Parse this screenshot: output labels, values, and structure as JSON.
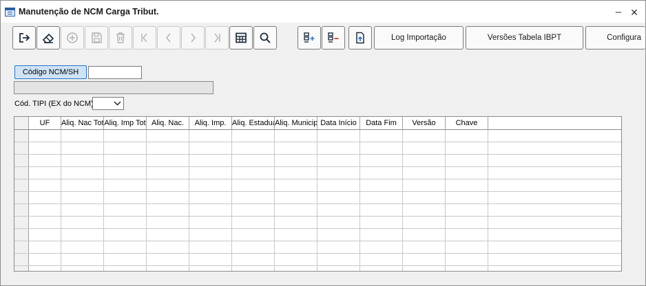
{
  "window": {
    "title": "Manutenção de NCM Carga Tribut.",
    "minimize_glyph": "–",
    "close_glyph": "✕"
  },
  "toolbar": {
    "icon_buttons": [
      {
        "name": "exit-button",
        "icon": "exit-icon",
        "enabled": true
      },
      {
        "name": "clear-button",
        "icon": "eraser-icon",
        "enabled": true
      },
      {
        "name": "add-button",
        "icon": "plus-circle-icon",
        "enabled": false
      },
      {
        "name": "save-button",
        "icon": "save-icon",
        "enabled": false
      },
      {
        "name": "delete-button",
        "icon": "trash-icon",
        "enabled": false
      },
      {
        "name": "first-record-button",
        "icon": "first-icon",
        "enabled": false
      },
      {
        "name": "previous-record-button",
        "icon": "chevron-left-icon",
        "enabled": false
      },
      {
        "name": "next-record-button",
        "icon": "chevron-right-icon",
        "enabled": false
      },
      {
        "name": "last-record-button",
        "icon": "last-icon",
        "enabled": false
      },
      {
        "name": "grid-view-button",
        "icon": "table-icon",
        "enabled": true
      },
      {
        "name": "search-button",
        "icon": "search-icon",
        "enabled": true
      },
      {
        "name": "add-row-button",
        "icon": "list-add-icon",
        "enabled": true
      },
      {
        "name": "remove-row-button",
        "icon": "list-remove-icon",
        "enabled": true
      },
      {
        "name": "import-file-button",
        "icon": "file-upload-icon",
        "enabled": true
      }
    ],
    "log_import_label": "Log Importação",
    "ibpt_versions_label": "Versões Tabela IBPT",
    "configure_label": "Configura"
  },
  "form": {
    "ncm_button_label": "Código NCM/SH",
    "ncm_value": "",
    "description_value": "",
    "tipi_label": "Cód. TIPI (EX do NCM)",
    "tipi_value": ""
  },
  "grid": {
    "columns": [
      "UF",
      "Aliq. Nac Tot",
      "Aliq. Imp Tot",
      "Aliq. Nac.",
      "Aliq. Imp.",
      "Aliq. Estadual",
      "Aliq. Municipal",
      "Data Início",
      "Data Fim",
      "Versão",
      "Chave"
    ],
    "rows": [
      [],
      [],
      [],
      [],
      [],
      [],
      [],
      [],
      [],
      [],
      [],
      []
    ]
  },
  "colors": {
    "accent_blue": "#2a72c4",
    "button_selected_bg": "#cfe3f7",
    "icon_dark": "#1f2d3d",
    "icon_disabled": "#b4b4b4"
  }
}
